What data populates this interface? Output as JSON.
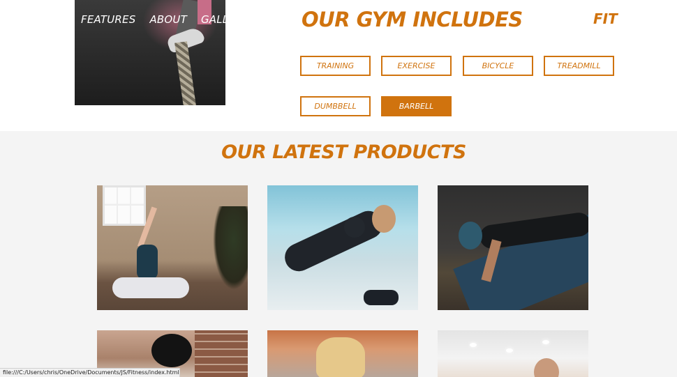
{
  "nav": {
    "items": [
      "FEATURES",
      "ABOUT",
      "GALLERY"
    ]
  },
  "gym_section": {
    "title": "OUR GYM INCLUDES",
    "logo": "FIT",
    "filters": [
      "TRAINING",
      "EXERCISE",
      "BICYCLE",
      "TREADMILL",
      "DUMBBELL",
      "BARBELL"
    ],
    "active_filter": "BARBELL"
  },
  "products_section": {
    "title": "OUR LATEST PRODUCTS",
    "images": [
      "yoga-pose-image",
      "dumbbell-row-image",
      "pushup-image",
      "group-training-image",
      "blonde-athlete-image",
      "gym-woman-image"
    ]
  },
  "status_bar": {
    "url": "file:///C:/Users/chris/OneDrive/Documents/JS/Fitness/index.html#"
  },
  "colors": {
    "accent": "#d0730e",
    "background": "#f4f4f4",
    "top_band": "#ffffff"
  }
}
